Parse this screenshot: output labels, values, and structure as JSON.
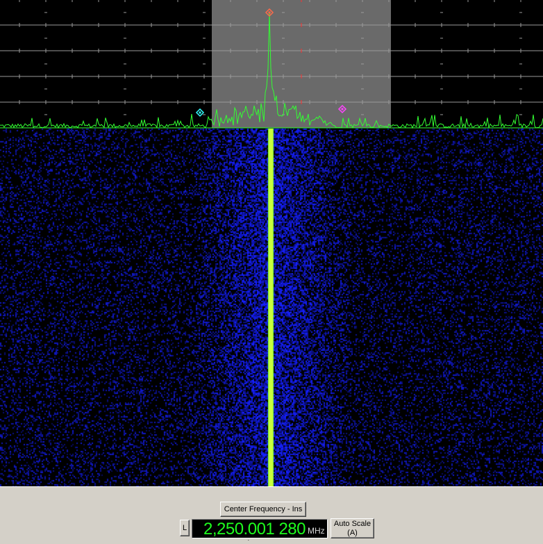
{
  "spectrum": {
    "background": "#000000",
    "trace_color": "#33ff33",
    "passband_color": "#6a6a6a",
    "grid_color": "#9a9a9a",
    "markers": [
      {
        "name": "peak-marker",
        "color": "#ff6a4a"
      },
      {
        "name": "left-marker",
        "color": "#33ffff"
      },
      {
        "name": "right-marker",
        "color": "#ff44ff"
      }
    ]
  },
  "waterfall": {
    "noise_color": "#1428ff",
    "signal_color": "#c8ff3c"
  },
  "controls": {
    "center_frequency_label": "Center Frequency - Ins",
    "l_label": "L",
    "frequency_value": "2,250.001 280",
    "frequency_unit": "MHz",
    "auto_scale_line1": "Auto Scale",
    "auto_scale_line2": "(A)"
  }
}
